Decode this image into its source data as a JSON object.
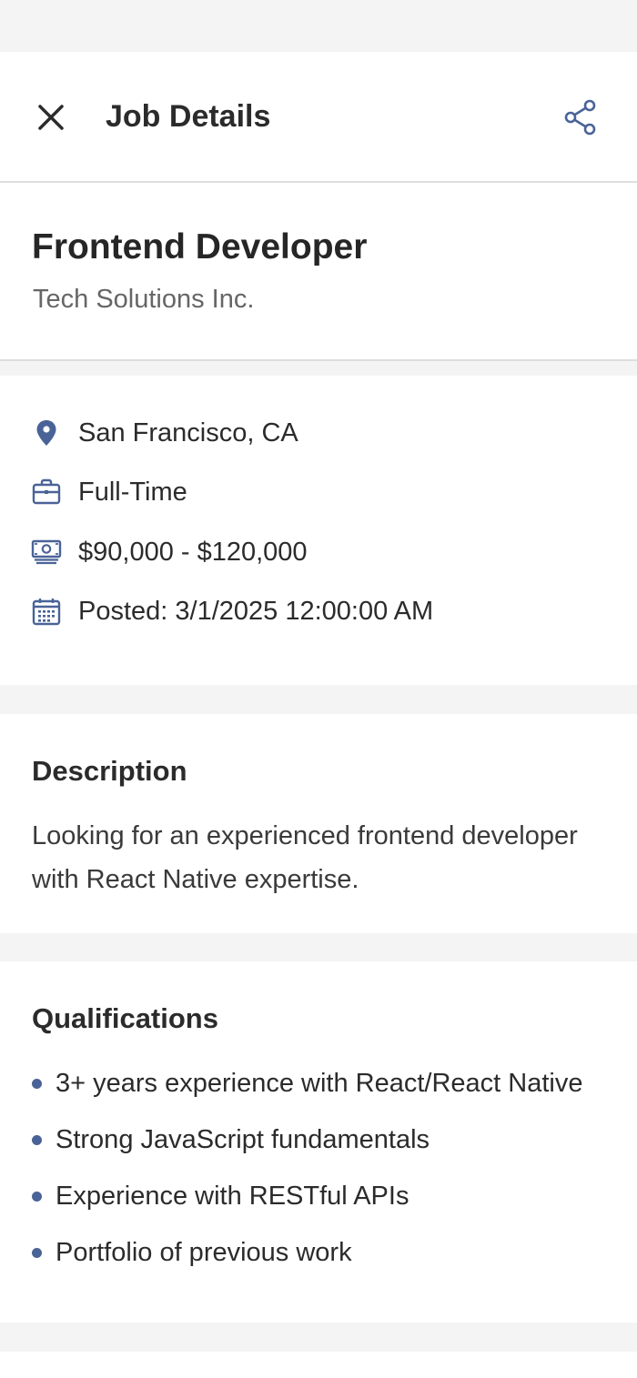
{
  "colors": {
    "accent": "#4a6397",
    "background": "#f4f4f4",
    "card": "#ffffff",
    "text": "#2b2b2b",
    "muted": "#666666"
  },
  "header": {
    "title": "Job Details",
    "close_icon": "close-icon",
    "share_icon": "share-icon"
  },
  "job": {
    "title": "Frontend Developer",
    "company": "Tech Solutions Inc."
  },
  "info": [
    {
      "icon": "location-pin-icon",
      "text": "San Francisco, CA"
    },
    {
      "icon": "briefcase-icon",
      "text": "Full-Time"
    },
    {
      "icon": "money-icon",
      "text": "$90,000 - $120,000"
    },
    {
      "icon": "calendar-icon",
      "text": "Posted: 3/1/2025 12:00:00 AM"
    }
  ],
  "description": {
    "heading": "Description",
    "text": "Looking for an experienced frontend developer with React Native expertise."
  },
  "qualifications": {
    "heading": "Qualifications",
    "items": [
      "3+ years experience with React/React Native",
      "Strong JavaScript fundamentals",
      "Experience with RESTful APIs",
      "Portfolio of previous work"
    ]
  }
}
